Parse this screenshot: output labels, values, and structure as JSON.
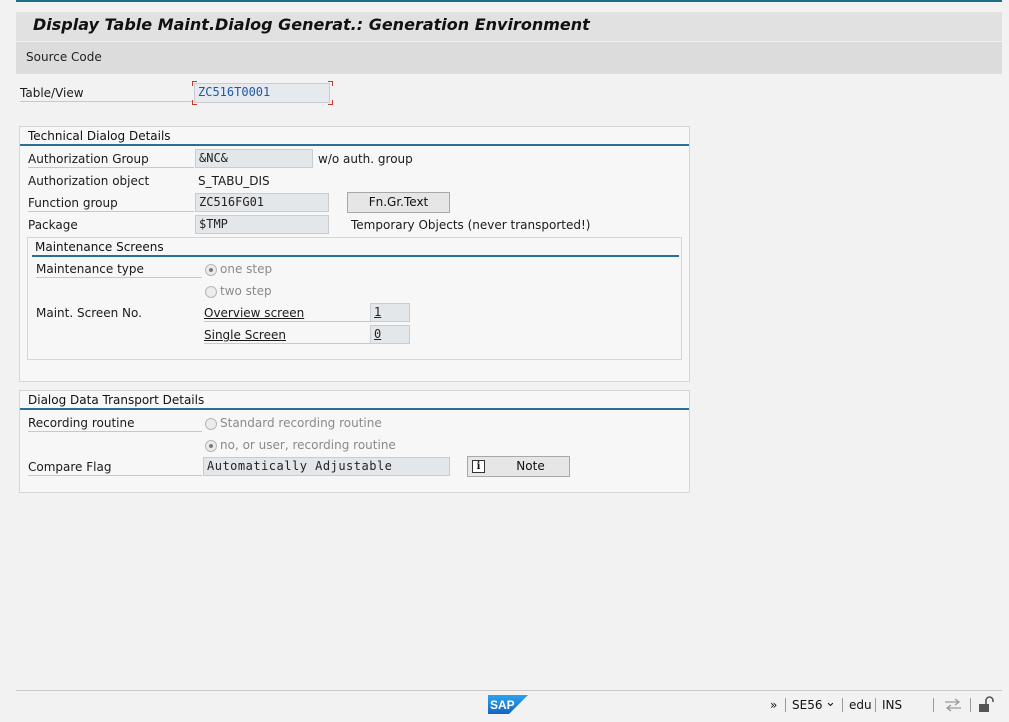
{
  "window": {
    "title": "Display Table Maint.Dialog Generat.: Generation Environment"
  },
  "toolbar": {
    "source_code_label": "Source Code"
  },
  "header": {
    "table_view_label": "Table/View",
    "table_view_value": "ZC516T0001"
  },
  "technical": {
    "title": "Technical Dialog Details",
    "auth_group_label": "Authorization Group",
    "auth_group_value": "&NC&",
    "auth_group_desc": "w/o auth. group",
    "auth_object_label": "Authorization object",
    "auth_object_value": "S_TABU_DIS",
    "function_group_label": "Function group",
    "function_group_value": "ZC516FG01",
    "fn_gr_text_button": "Fn.Gr.Text",
    "package_label": "Package",
    "package_value": "$TMP",
    "package_desc": "Temporary Objects (never transported!)"
  },
  "maintenance": {
    "title": "Maintenance Screens",
    "type_label": "Maintenance type",
    "one_step_label": "one step",
    "two_step_label": "two step",
    "screen_no_label": "Maint. Screen No.",
    "overview_label": "Overview screen",
    "overview_value": "1",
    "single_label": "Single Screen",
    "single_value": "0"
  },
  "transport": {
    "title": "Dialog Data Transport Details",
    "recording_label": "Recording routine",
    "standard_label": "Standard recording routine",
    "no_user_label": "no, or user, recording routine",
    "compare_label": "Compare Flag",
    "compare_value": "Automatically Adjustable",
    "note_button": "Note"
  },
  "statusbar": {
    "more": "»",
    "transaction": "SE56",
    "chevron": "⌄",
    "system": "edu",
    "mode": "INS"
  },
  "colors": {
    "accent": "#2a6f95",
    "sap_blue": "#1b7fd1"
  }
}
